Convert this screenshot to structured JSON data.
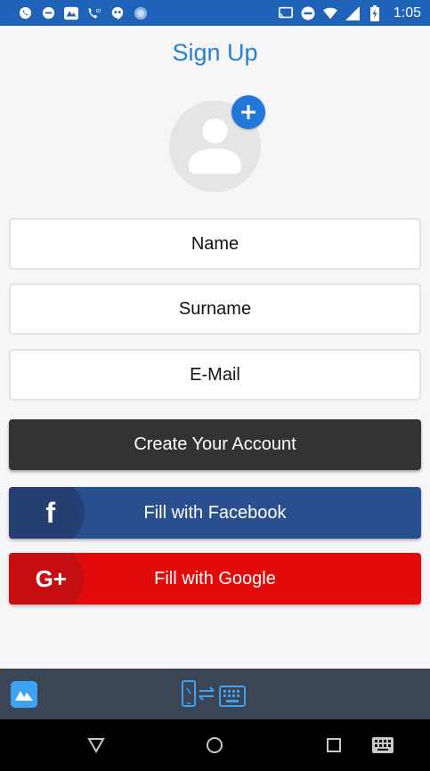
{
  "status_bar": {
    "time": "1:05",
    "icons": [
      "whatsapp-icon",
      "message-icon",
      "apowermirror-icon",
      "phone-hd-icon",
      "hangouts-icon",
      "sync-icon",
      "cast-icon",
      "do-not-disturb-icon",
      "wifi-icon",
      "signal-icon",
      "battery-charging-icon"
    ]
  },
  "page": {
    "title": "Sign Up"
  },
  "form": {
    "name_placeholder": "Name",
    "surname_placeholder": "Surname",
    "email_placeholder": "E-Mail"
  },
  "buttons": {
    "create_account": "Create Your Account",
    "facebook": "Fill with Facebook",
    "facebook_icon_text": "f",
    "google": "Fill with Google",
    "google_icon_text": "G+"
  },
  "colors": {
    "status_bar": "#1e63b8",
    "title": "#2a7fcf",
    "create_button": "#343233",
    "facebook": "#2a4f8f",
    "google": "#e10b0b",
    "app_bar": "#3b4556"
  }
}
